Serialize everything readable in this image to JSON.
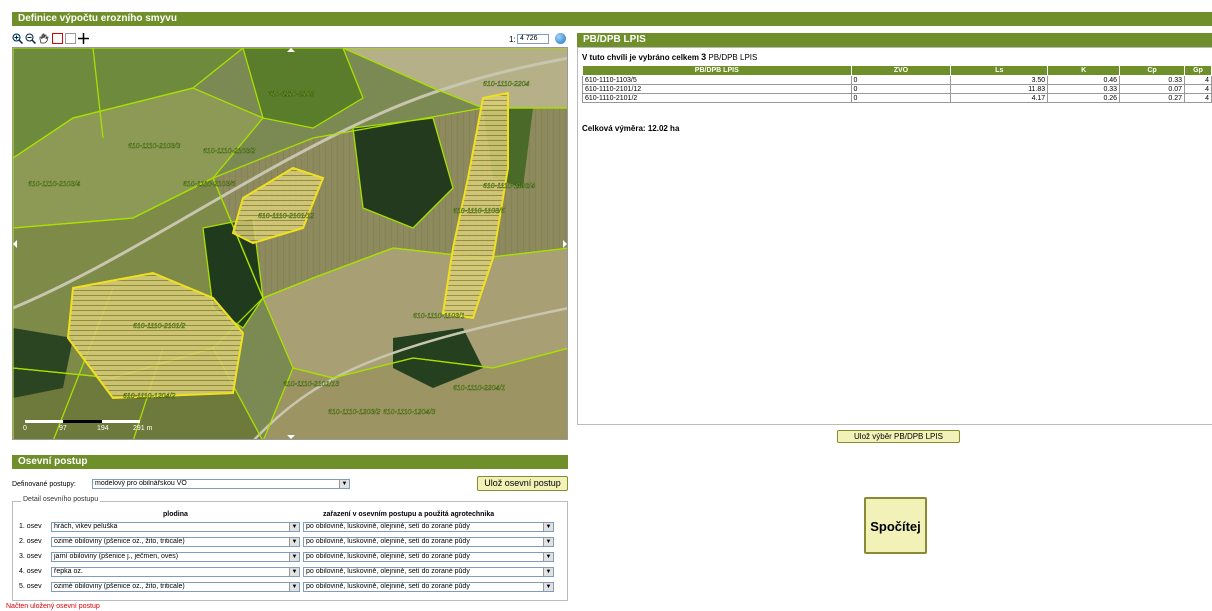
{
  "header": {
    "title": "Definice výpočtu erozního smyvu"
  },
  "map": {
    "scale_prefix": "1:",
    "scale_value": "4 726",
    "scale_bar": [
      "0",
      "97",
      "194",
      "291 m"
    ],
    "parcel_labels": [
      "610-1110-2102",
      "610-1110-2103/2",
      "610-1110-2103/3",
      "610-1110-2103/6",
      "610-1110-2101/12",
      "610-1110-1103/4",
      "610-1110-1103/5",
      "610-1110-2101/2",
      "610-1110-1103/1",
      "610-1110-1204/2",
      "610-1110-2101/13",
      "610-1110-2204/1",
      "610-1110-1203/2",
      "610-1110-1204/3",
      "610-1110-2204",
      "610-1110-2103/4"
    ]
  },
  "lpis": {
    "title": "PB/DPB LPIS",
    "summary_prefix": "V tuto chvíli je vybráno celkem",
    "summary_count": "3",
    "summary_suffix": "PB/DPB LPIS",
    "columns": [
      "PB/DPB LPIS",
      "ZVO",
      "Ls",
      "K",
      "Cp",
      "Gp"
    ],
    "rows": [
      [
        "610-1110-1103/5",
        "0",
        "3.50",
        "0.46",
        "0.33",
        "4"
      ],
      [
        "610-1110-2101/12",
        "0",
        "11.83",
        "0.33",
        "0.07",
        "4"
      ],
      [
        "610-1110-2101/2",
        "0",
        "4.17",
        "0.26",
        "0.27",
        "4"
      ]
    ],
    "total": "Celková výměra: 12.02 ha",
    "save_button": "Ulož výběr PB/DPB LPIS"
  },
  "osevni": {
    "title": "Osevní postup",
    "defined_label": "Definované postupy:",
    "defined_value": "modelový pro obilnářskou VO",
    "save_button": "Ulož osevní postup",
    "detail_legend": "Detail osevního postupu",
    "col_crop": "plodina",
    "col_agro": "zařazení v osevním postupu a použitá agrotechnika",
    "rows": [
      {
        "label": "1. osev",
        "crop": "hrách, vikev peluška",
        "agro": "po obilovině, luskovině, olejnině, setí do zorané půdy"
      },
      {
        "label": "2. osev",
        "crop": "ozimé obiloviny (pšenice oz., žito, triticale)",
        "agro": "po obilovině, luskovině, olejnině, setí do zorané půdy"
      },
      {
        "label": "3. osev",
        "crop": "jarní obiloviny (pšenice j., ječmen, oves)",
        "agro": "po obilovině, luskovině, olejnině, setí do zorané půdy"
      },
      {
        "label": "4. osev",
        "crop": "řepka oz.",
        "agro": "po obilovině, luskovině, olejnině, setí do zorané půdy"
      },
      {
        "label": "5. osev",
        "crop": "ozimé obiloviny (pšenice oz., žito, triticale)",
        "agro": "po obilovině, luskovině, olejnině, setí do zorané půdy"
      }
    ],
    "status": "Načten uložený osevní postup"
  },
  "compute_button": "Spočítej",
  "colors": {
    "accent": "#6f8f2a",
    "button_bg": "#f1f1b8",
    "parcel_border": "#a8e000",
    "selected": "#f0e020",
    "status": "#e00000"
  }
}
